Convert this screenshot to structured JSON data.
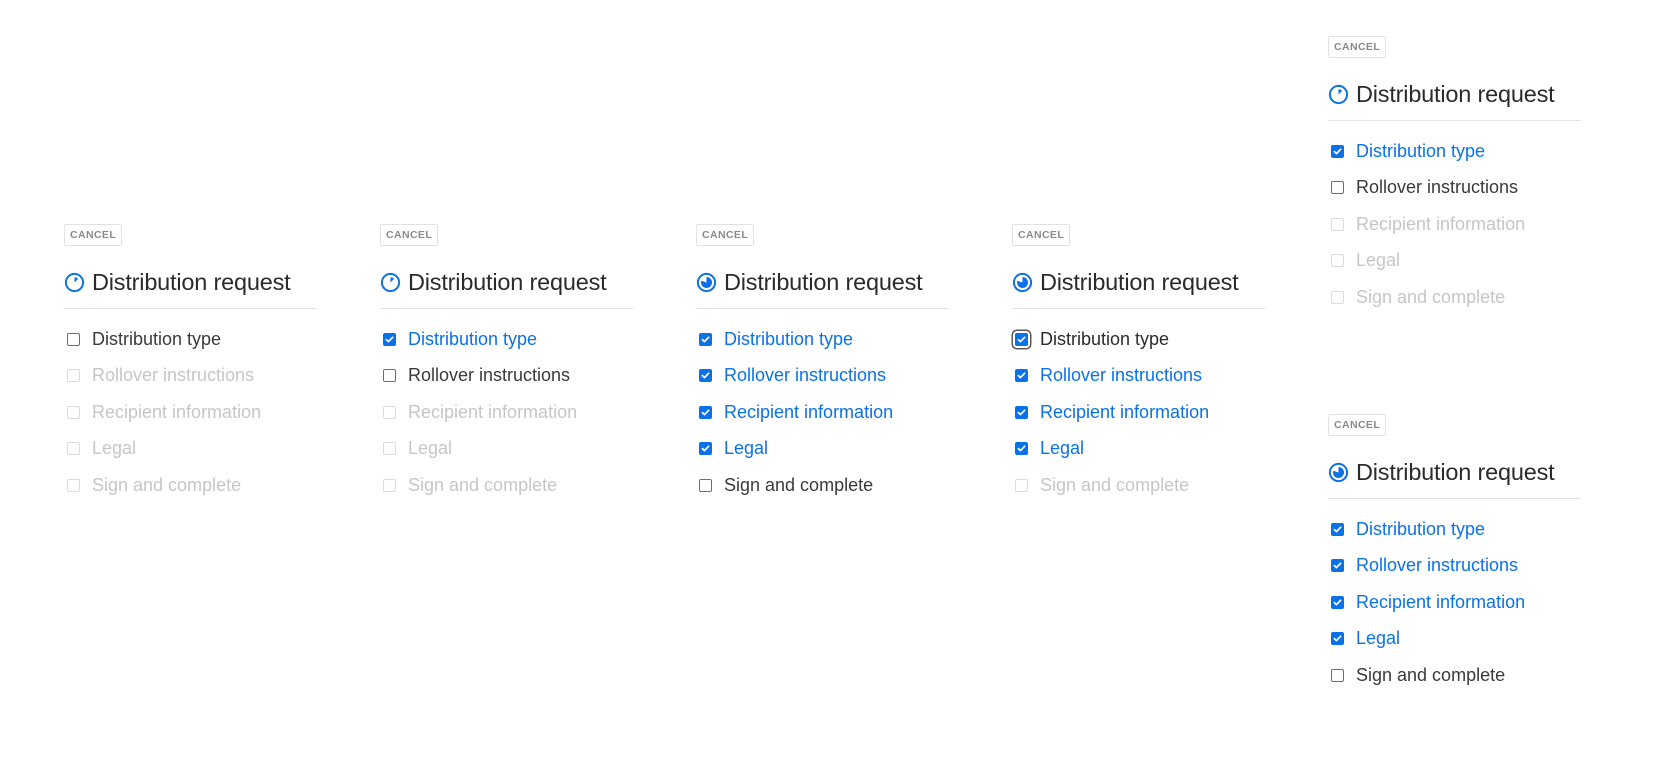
{
  "colors": {
    "accent": "#0a72e8",
    "text": "#2b2b2b",
    "muted": "#c6c6c6",
    "border": "#e4e4e4"
  },
  "panels": [
    {
      "cancel_label": "CANCEL",
      "title": "Distribution request",
      "progress_icon": "progress-quarter-icon",
      "steps": [
        {
          "label": "Distribution type",
          "state": "active"
        },
        {
          "label": "Rollover instructions",
          "state": "disabled"
        },
        {
          "label": "Recipient information",
          "state": "disabled"
        },
        {
          "label": "Legal",
          "state": "disabled"
        },
        {
          "label": "Sign and complete",
          "state": "disabled"
        }
      ]
    },
    {
      "cancel_label": "CANCEL",
      "title": "Distribution request",
      "progress_icon": "progress-quarter-icon",
      "steps": [
        {
          "label": "Distribution type",
          "state": "checked"
        },
        {
          "label": "Rollover instructions",
          "state": "active"
        },
        {
          "label": "Recipient information",
          "state": "disabled"
        },
        {
          "label": "Legal",
          "state": "disabled"
        },
        {
          "label": "Sign and complete",
          "state": "disabled"
        }
      ]
    },
    {
      "cancel_label": "CANCEL",
      "title": "Distribution request",
      "progress_icon": "progress-mostly-complete-icon",
      "steps": [
        {
          "label": "Distribution type",
          "state": "checked"
        },
        {
          "label": "Rollover instructions",
          "state": "checked"
        },
        {
          "label": "Recipient information",
          "state": "checked"
        },
        {
          "label": "Legal",
          "state": "checked"
        },
        {
          "label": "Sign and complete",
          "state": "active"
        }
      ]
    },
    {
      "cancel_label": "CANCEL",
      "title": "Distribution request",
      "progress_icon": "progress-mostly-complete-icon",
      "steps": [
        {
          "label": "Distribution type",
          "state": "focused"
        },
        {
          "label": "Rollover instructions",
          "state": "checked"
        },
        {
          "label": "Recipient information",
          "state": "checked"
        },
        {
          "label": "Legal",
          "state": "checked"
        },
        {
          "label": "Sign and complete",
          "state": "disabled"
        }
      ]
    },
    {
      "cancel_label": "CANCEL",
      "title": "Distribution request",
      "progress_icon": "progress-quarter-icon",
      "steps": [
        {
          "label": "Distribution type",
          "state": "checked"
        },
        {
          "label": "Rollover instructions",
          "state": "active"
        },
        {
          "label": "Recipient information",
          "state": "disabled"
        },
        {
          "label": "Legal",
          "state": "disabled"
        },
        {
          "label": "Sign and complete",
          "state": "disabled"
        }
      ]
    },
    {
      "cancel_label": "CANCEL",
      "title": "Distribution request",
      "progress_icon": "progress-mostly-complete-icon",
      "steps": [
        {
          "label": "Distribution type",
          "state": "checked"
        },
        {
          "label": "Rollover instructions",
          "state": "checked"
        },
        {
          "label": "Recipient information",
          "state": "checked"
        },
        {
          "label": "Legal",
          "state": "checked"
        },
        {
          "label": "Sign and complete",
          "state": "active"
        }
      ]
    }
  ]
}
